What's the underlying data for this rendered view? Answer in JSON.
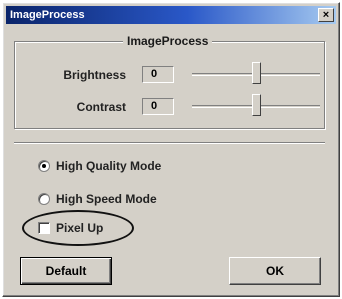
{
  "window": {
    "title": "ImageProcess",
    "close_glyph": "×"
  },
  "group": {
    "title": "ImageProcess",
    "rows": [
      {
        "label": "Brightness",
        "value": "0",
        "slider_fraction": 0.5
      },
      {
        "label": "Contrast",
        "value": "0",
        "slider_fraction": 0.5
      }
    ]
  },
  "modes": [
    {
      "label": "High Quality Mode",
      "checked": true
    },
    {
      "label": "High Speed Mode",
      "checked": false
    }
  ],
  "pixel_up": {
    "label": "Pixel Up",
    "checked": false
  },
  "buttons": {
    "default_label": "Default",
    "ok_label": "OK"
  }
}
